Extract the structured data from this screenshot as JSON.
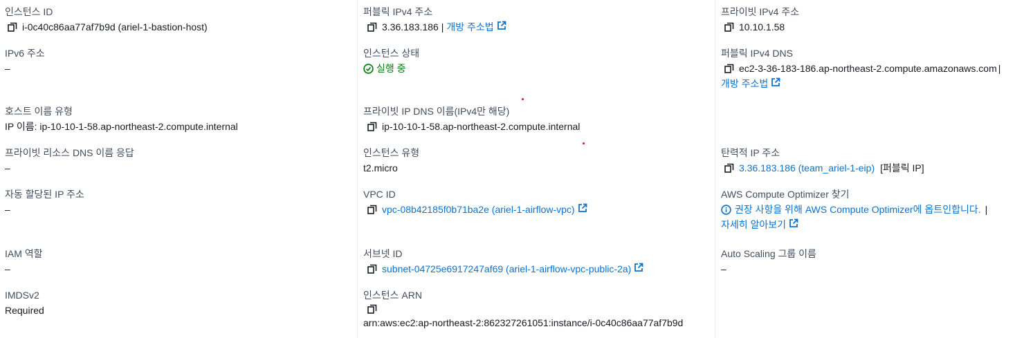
{
  "col1": {
    "instance_id": {
      "label": "인스턴스 ID",
      "value": "i-0c40c86aa77af7b9d (ariel-1-bastion-host)"
    },
    "ipv6": {
      "label": "IPv6 주소",
      "value": "–"
    },
    "hostname_type": {
      "label": "호스트 이름 유형",
      "value": "IP 이름: ip-10-10-1-58.ap-northeast-2.compute.internal"
    },
    "private_dns_answer": {
      "label": "프라이빗 리소스 DNS 이름 응답",
      "value": "–"
    },
    "auto_ip": {
      "label": "자동 할당된 IP 주소",
      "value": "–"
    },
    "iam_role": {
      "label": "IAM 역할",
      "value": "–"
    },
    "imdsv2": {
      "label": "IMDSv2",
      "value": "Required"
    }
  },
  "col2": {
    "public_ipv4": {
      "label": "퍼블릭 IPv4 주소",
      "value": "3.36.183.186",
      "sep": "|",
      "link": "개방 주소법"
    },
    "instance_state": {
      "label": "인스턴스 상태",
      "value": "실행 중"
    },
    "private_ip_dns": {
      "label": "프라이빗 IP DNS 이름(IPv4만 해당)",
      "value": "ip-10-10-1-58.ap-northeast-2.compute.internal"
    },
    "instance_type": {
      "label": "인스턴스 유형",
      "value": "t2.micro"
    },
    "vpc_id": {
      "label": "VPC ID",
      "link": "vpc-08b42185f0b71ba2e (ariel-1-airflow-vpc)"
    },
    "subnet_id": {
      "label": "서브넷 ID",
      "link": "subnet-04725e6917247af69 (ariel-1-airflow-vpc-public-2a)"
    },
    "instance_arn": {
      "label": "인스턴스 ARN",
      "value": "arn:aws:ec2:ap-northeast-2:862327261051:instance/i-0c40c86aa77af7b9d"
    }
  },
  "col3": {
    "private_ipv4": {
      "label": "프라이빗 IPv4 주소",
      "value": "10.10.1.58"
    },
    "public_ipv4_dns": {
      "label": "퍼블릭 IPv4 DNS",
      "value": "ec2-3-36-183-186.ap-northeast-2.compute.amazonaws.com",
      "sep": "|",
      "link": "개방 주소법"
    },
    "elastic_ip": {
      "label": "탄력적 IP 주소",
      "link": "3.36.183.186 (team_ariel-1-eip)",
      "suffix": "[퍼블릭 IP]"
    },
    "compute_optimizer": {
      "label": "AWS Compute Optimizer 찾기",
      "link": "권장 사항을 위해 AWS Compute Optimizer에 옵트인합니다.",
      "sep": "|",
      "link2": "자세히 알아보기"
    },
    "autoscaling_group": {
      "label": "Auto Scaling 그룹 이름",
      "value": "–"
    }
  },
  "colors": {
    "link": "#0972d3",
    "success": "#037f0c",
    "label": "#414d5c",
    "text": "#16191f"
  }
}
